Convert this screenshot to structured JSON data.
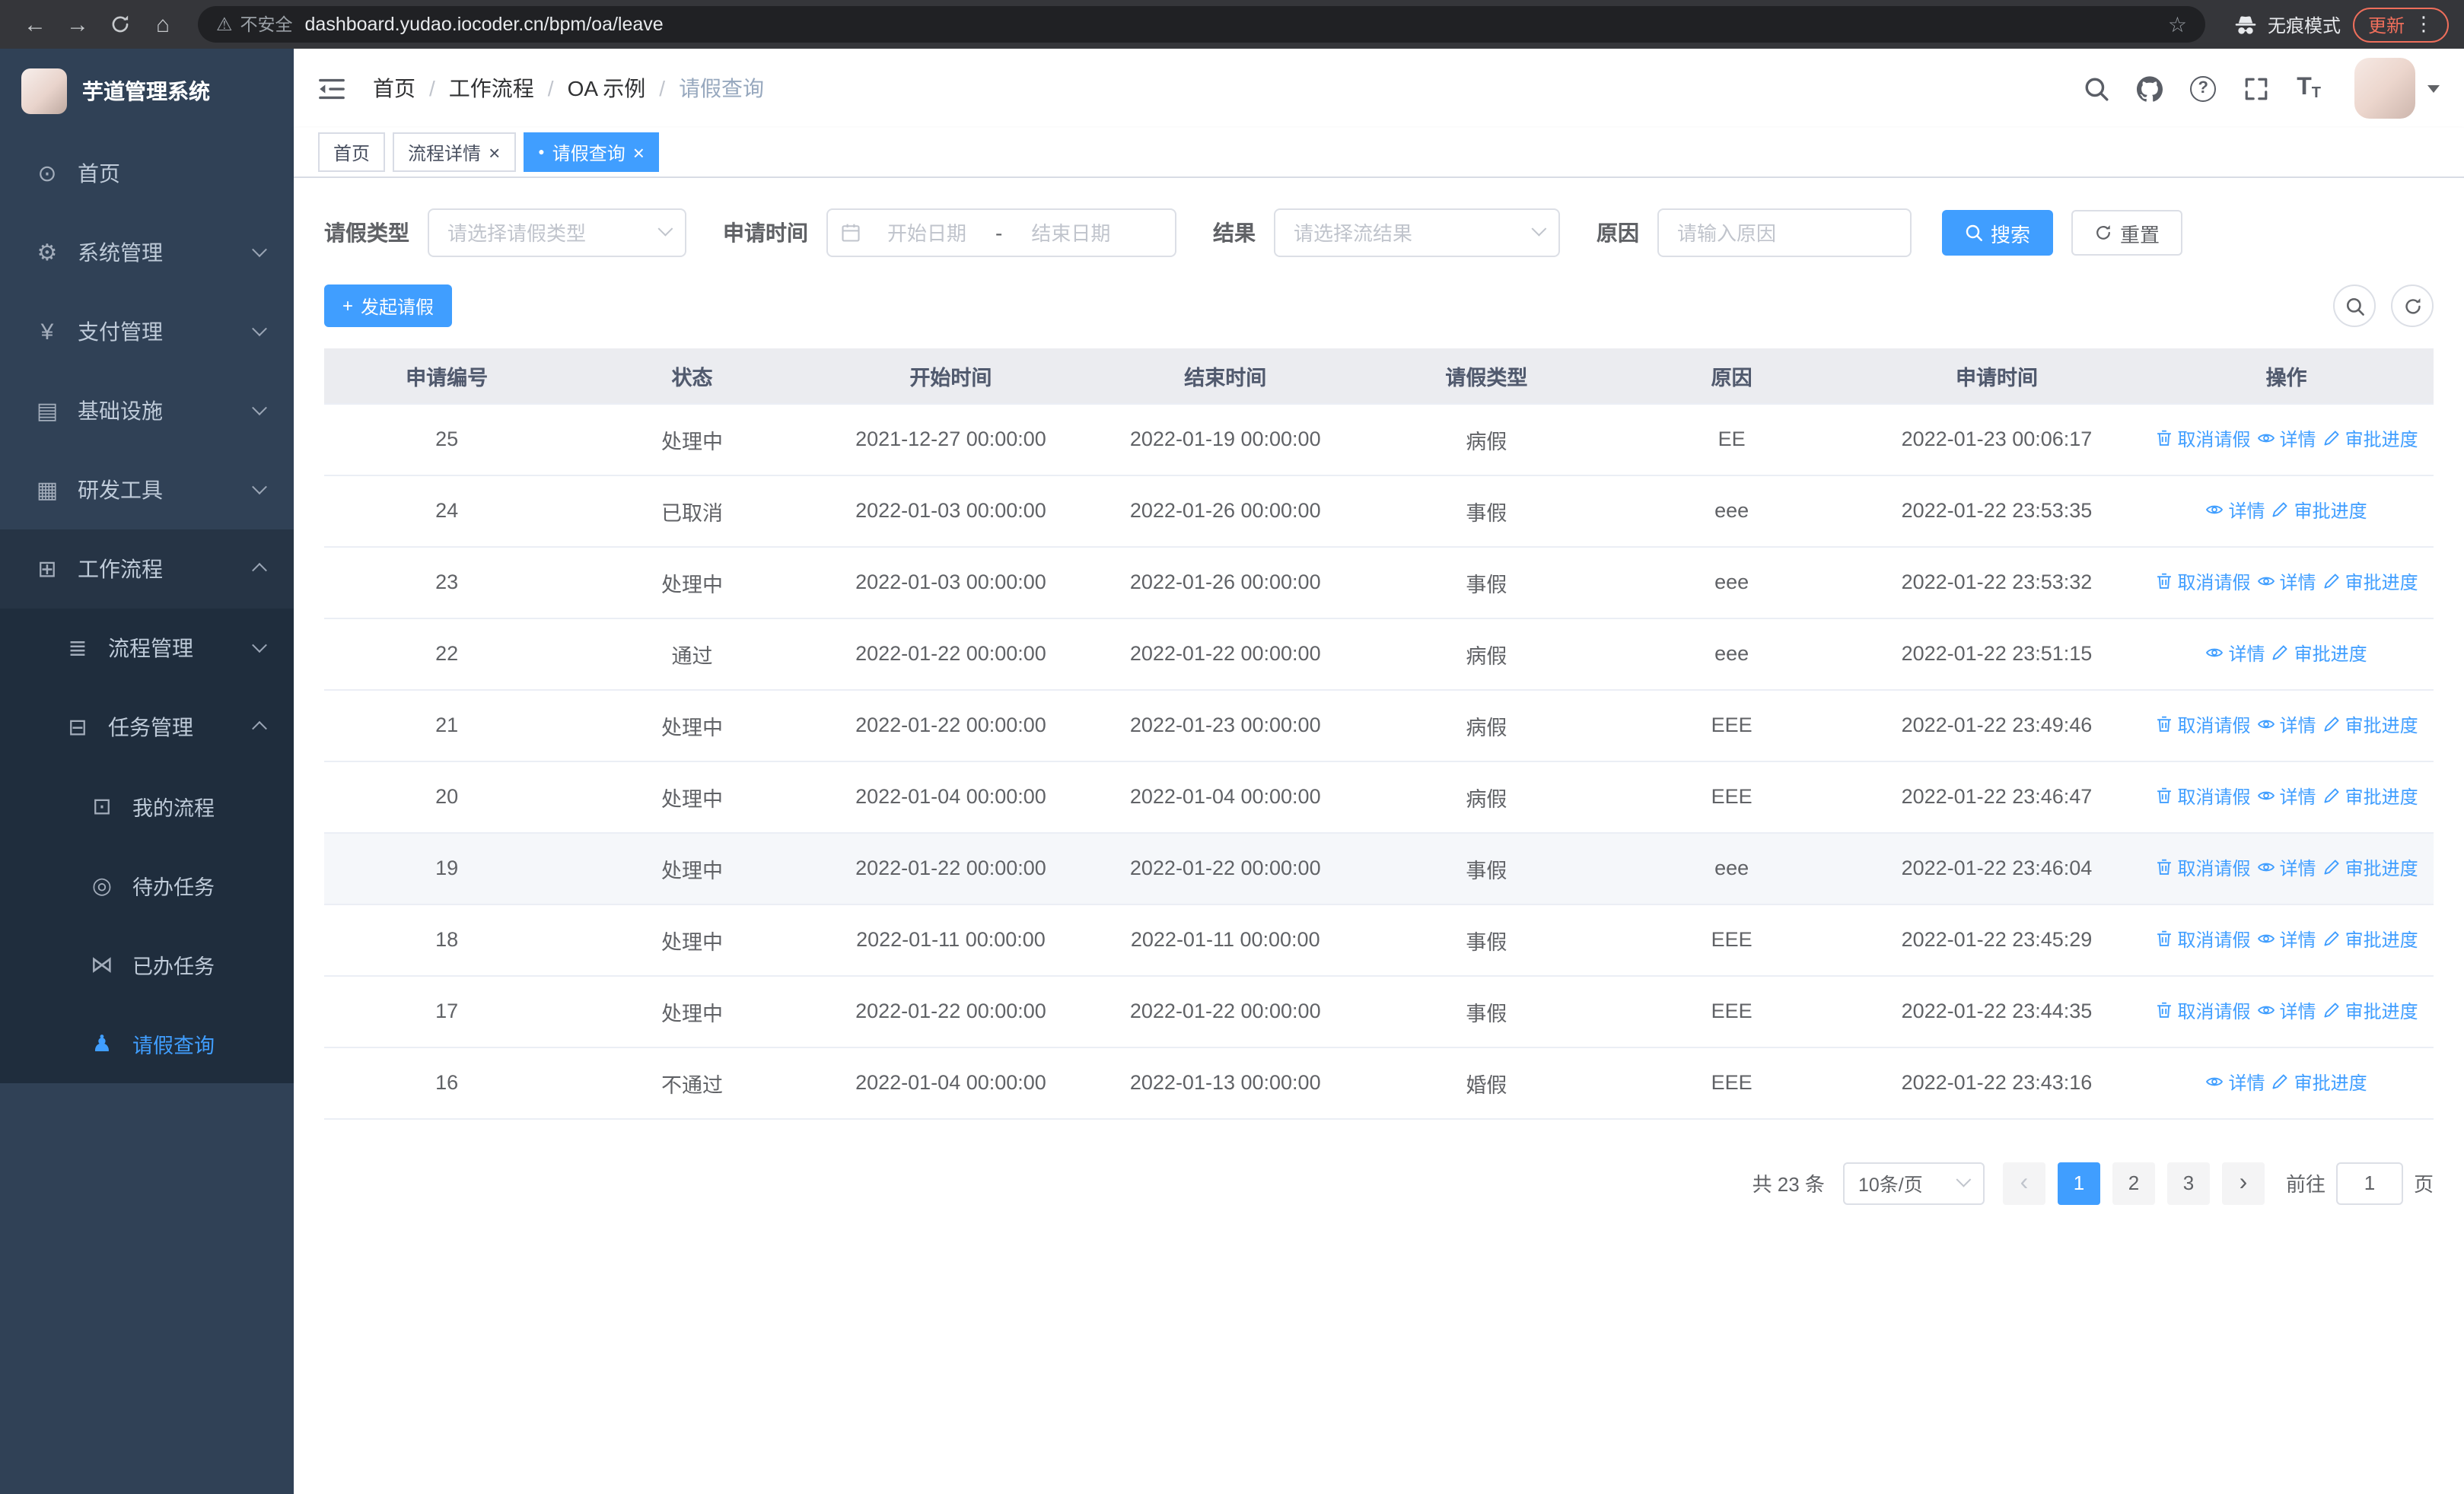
{
  "colors": {
    "primary": "#409eff",
    "sidebar_bg": "#304156",
    "submenu_bg": "#1f2d3d",
    "tab_active": "#409eff",
    "table_header_bg": "#ebecf0",
    "update_chip": "#ee6e5b"
  },
  "icon_glyphs": {
    "back-icon": "←",
    "forward-icon": "→",
    "home-icon": "⌂",
    "warning-icon": "⚠",
    "star-icon": "☆",
    "kebab-icon": "⋮",
    "help-icon": "?",
    "font-size-icon": "T",
    "breadcrumb-separator": "/",
    "dot-icon": "●",
    "close-icon": "×",
    "plus-icon": "+",
    "prev-icon": "‹",
    "next-icon": "›",
    "dashboard-icon": "⊙",
    "gear-icon": "⚙",
    "yen-icon": "¥",
    "infra-icon": "▤",
    "tools-icon": "▦",
    "workflow-icon": "⊞",
    "process-icon": "≣",
    "task-icon": "⊟",
    "my-process-icon": "⊡",
    "todo-icon": "◎",
    "done-icon": "⋈",
    "user-icon": "♟"
  },
  "browser": {
    "url": "dashboard.yudao.iocoder.cn/bpm/oa/leave",
    "security_label": "不安全",
    "incognito_label": "无痕模式",
    "update_label": "更新"
  },
  "sidebar": {
    "app_title": "芋道管理系统",
    "items": [
      {
        "name": "home",
        "label": "首页",
        "icon": "dashboard-icon",
        "level": 1,
        "expandable": false,
        "expanded": false,
        "active": false
      },
      {
        "name": "system-management",
        "label": "系统管理",
        "icon": "gear-icon",
        "level": 1,
        "expandable": true,
        "expanded": false,
        "active": false
      },
      {
        "name": "payment-management",
        "label": "支付管理",
        "icon": "yen-icon",
        "level": 1,
        "expandable": true,
        "expanded": false,
        "active": false
      },
      {
        "name": "infrastructure",
        "label": "基础设施",
        "icon": "infra-icon",
        "level": 1,
        "expandable": true,
        "expanded": false,
        "active": false
      },
      {
        "name": "dev-tools",
        "label": "研发工具",
        "icon": "tools-icon",
        "level": 1,
        "expandable": true,
        "expanded": false,
        "active": false
      },
      {
        "name": "workflow",
        "label": "工作流程",
        "icon": "workflow-icon",
        "level": 1,
        "expandable": true,
        "expanded": true,
        "active": false
      },
      {
        "name": "process-management",
        "label": "流程管理",
        "icon": "process-icon",
        "level": 2,
        "expandable": true,
        "expanded": false,
        "active": false
      },
      {
        "name": "task-management",
        "label": "任务管理",
        "icon": "task-icon",
        "level": 2,
        "expandable": true,
        "expanded": true,
        "active": false
      },
      {
        "name": "my-processes",
        "label": "我的流程",
        "icon": "my-process-icon",
        "level": 3,
        "expandable": false,
        "expanded": false,
        "active": false
      },
      {
        "name": "todo-tasks",
        "label": "待办任务",
        "icon": "todo-icon",
        "level": 3,
        "expandable": false,
        "expanded": false,
        "active": false
      },
      {
        "name": "done-tasks",
        "label": "已办任务",
        "icon": "done-icon",
        "level": 3,
        "expandable": false,
        "expanded": false,
        "active": false
      },
      {
        "name": "leave-query",
        "label": "请假查询",
        "icon": "user-icon",
        "level": 3,
        "expandable": false,
        "expanded": false,
        "active": true
      }
    ]
  },
  "header": {
    "breadcrumb": [
      "首页",
      "工作流程",
      "OA 示例",
      "请假查询"
    ]
  },
  "tabs": [
    {
      "name": "home",
      "label": "首页",
      "closable": false,
      "active": false
    },
    {
      "name": "process-detail",
      "label": "流程详情",
      "closable": true,
      "active": false
    },
    {
      "name": "leave-query",
      "label": "请假查询",
      "closable": true,
      "active": true
    }
  ],
  "filters": {
    "leave_type_label": "请假类型",
    "leave_type_placeholder": "请选择请假类型",
    "apply_time_label": "申请时间",
    "start_date_placeholder": "开始日期",
    "date_separator": "-",
    "end_date_placeholder": "结束日期",
    "result_label": "结果",
    "result_placeholder": "请选择流结果",
    "reason_label": "原因",
    "reason_placeholder": "请输入原因",
    "search_label": "搜索",
    "reset_label": "重置"
  },
  "toolbar": {
    "create_label": "发起请假"
  },
  "table": {
    "columns": [
      "申请编号",
      "状态",
      "开始时间",
      "结束时间",
      "请假类型",
      "原因",
      "申请时间",
      "操作"
    ],
    "action_labels": {
      "cancel": "取消请假",
      "detail": "详情",
      "progress": "审批进度"
    },
    "action_icons": {
      "cancel": "trash-icon",
      "detail": "eye-icon",
      "progress": "edit-icon"
    },
    "rows": [
      {
        "id": "25",
        "status": "处理中",
        "start": "2021-12-27 00:00:00",
        "end": "2022-01-19 00:00:00",
        "type": "病假",
        "reason": "EE",
        "applied": "2022-01-23 00:06:17",
        "actions": [
          "cancel",
          "detail",
          "progress"
        ],
        "highlight": false
      },
      {
        "id": "24",
        "status": "已取消",
        "start": "2022-01-03 00:00:00",
        "end": "2022-01-26 00:00:00",
        "type": "事假",
        "reason": "eee",
        "applied": "2022-01-22 23:53:35",
        "actions": [
          "detail",
          "progress"
        ],
        "highlight": false
      },
      {
        "id": "23",
        "status": "处理中",
        "start": "2022-01-03 00:00:00",
        "end": "2022-01-26 00:00:00",
        "type": "事假",
        "reason": "eee",
        "applied": "2022-01-22 23:53:32",
        "actions": [
          "cancel",
          "detail",
          "progress"
        ],
        "highlight": false
      },
      {
        "id": "22",
        "status": "通过",
        "start": "2022-01-22 00:00:00",
        "end": "2022-01-22 00:00:00",
        "type": "病假",
        "reason": "eee",
        "applied": "2022-01-22 23:51:15",
        "actions": [
          "detail",
          "progress"
        ],
        "highlight": false
      },
      {
        "id": "21",
        "status": "处理中",
        "start": "2022-01-22 00:00:00",
        "end": "2022-01-23 00:00:00",
        "type": "病假",
        "reason": "EEE",
        "applied": "2022-01-22 23:49:46",
        "actions": [
          "cancel",
          "detail",
          "progress"
        ],
        "highlight": false
      },
      {
        "id": "20",
        "status": "处理中",
        "start": "2022-01-04 00:00:00",
        "end": "2022-01-04 00:00:00",
        "type": "病假",
        "reason": "EEE",
        "applied": "2022-01-22 23:46:47",
        "actions": [
          "cancel",
          "detail",
          "progress"
        ],
        "highlight": false
      },
      {
        "id": "19",
        "status": "处理中",
        "start": "2022-01-22 00:00:00",
        "end": "2022-01-22 00:00:00",
        "type": "事假",
        "reason": "eee",
        "applied": "2022-01-22 23:46:04",
        "actions": [
          "cancel",
          "detail",
          "progress"
        ],
        "highlight": true
      },
      {
        "id": "18",
        "status": "处理中",
        "start": "2022-01-11 00:00:00",
        "end": "2022-01-11 00:00:00",
        "type": "事假",
        "reason": "EEE",
        "applied": "2022-01-22 23:45:29",
        "actions": [
          "cancel",
          "detail",
          "progress"
        ],
        "highlight": false
      },
      {
        "id": "17",
        "status": "处理中",
        "start": "2022-01-22 00:00:00",
        "end": "2022-01-22 00:00:00",
        "type": "事假",
        "reason": "EEE",
        "applied": "2022-01-22 23:44:35",
        "actions": [
          "cancel",
          "detail",
          "progress"
        ],
        "highlight": false
      },
      {
        "id": "16",
        "status": "不通过",
        "start": "2022-01-04 00:00:00",
        "end": "2022-01-13 00:00:00",
        "type": "婚假",
        "reason": "EEE",
        "applied": "2022-01-22 23:43:16",
        "actions": [
          "detail",
          "progress"
        ],
        "highlight": false
      }
    ]
  },
  "pagination": {
    "total_label": "共 23 条",
    "page_size": "10条/页",
    "pages": [
      "1",
      "2",
      "3"
    ],
    "active_page": "1",
    "goto_label": "前往",
    "goto_value": "1",
    "page_label": "页"
  }
}
